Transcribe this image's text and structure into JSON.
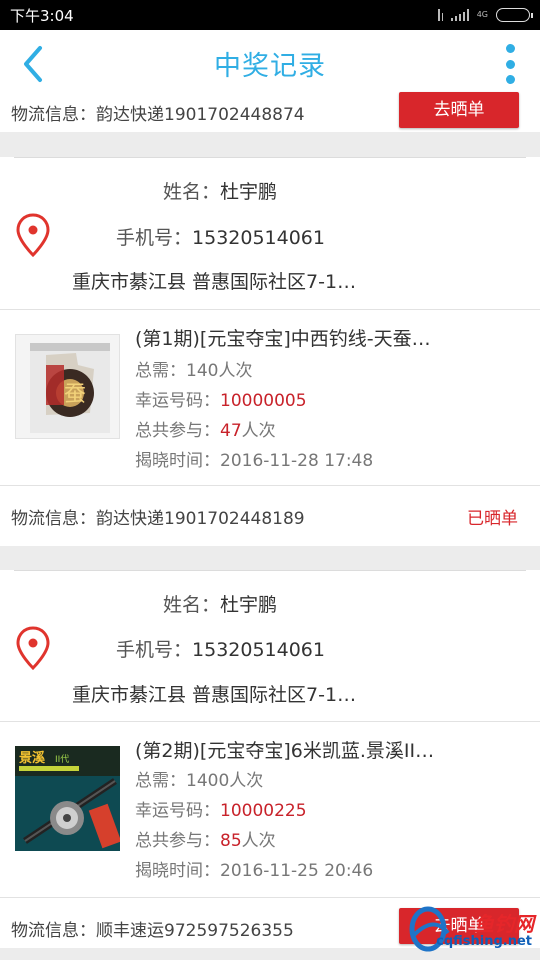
{
  "status_bar": {
    "time": "下午3:04",
    "network": "4G"
  },
  "header": {
    "title": "中奖记录",
    "back_icon": "chevron-left-icon",
    "more_icon": "more-vertical-icon"
  },
  "colors": {
    "accent": "#30aee4",
    "red": "#d8262b",
    "highlight": "#c8222a"
  },
  "top_logistics": {
    "label": "物流信息：韵达快递1901702448874",
    "action": "去晒单"
  },
  "records": [
    {
      "name_label": "姓名：",
      "name": "杜宇鹏",
      "phone_label": "手机号：",
      "phone": "15320514061",
      "address": "重庆市綦江县 普惠国际社区7-1…",
      "product": {
        "title": "(第1期)[元宝夺宝]中西钓线-天蚕…",
        "total_label": "总需：",
        "total": "140人次",
        "lucky_label": "幸运号码：",
        "lucky_number": "10000005",
        "participants_label": "总共参与：",
        "participants": "47",
        "participants_unit": "人次",
        "time_label": "揭晓时间：",
        "time": "2016-11-28 17:48"
      },
      "logistics": "物流信息：韵达快递1901702448189",
      "status": "已晒单"
    },
    {
      "name_label": "姓名：",
      "name": "杜宇鹏",
      "phone_label": "手机号：",
      "phone": "15320514061",
      "address": "重庆市綦江县 普惠国际社区7-1…",
      "product": {
        "title": "(第2期)[元宝夺宝]6米凯蓝.景溪II…",
        "total_label": "总需：",
        "total": "1400人次",
        "lucky_label": "幸运号码：",
        "lucky_number": "10000225",
        "participants_label": "总共参与：",
        "participants": "85",
        "participants_unit": "人次",
        "time_label": "揭晓时间：",
        "time": "2016-11-25 20:46"
      },
      "logistics": "物流信息：顺丰速运972597526355",
      "action": "去晒单"
    }
  ],
  "watermark": {
    "text": "鱼钓网",
    "url": "cqfishing.net"
  }
}
